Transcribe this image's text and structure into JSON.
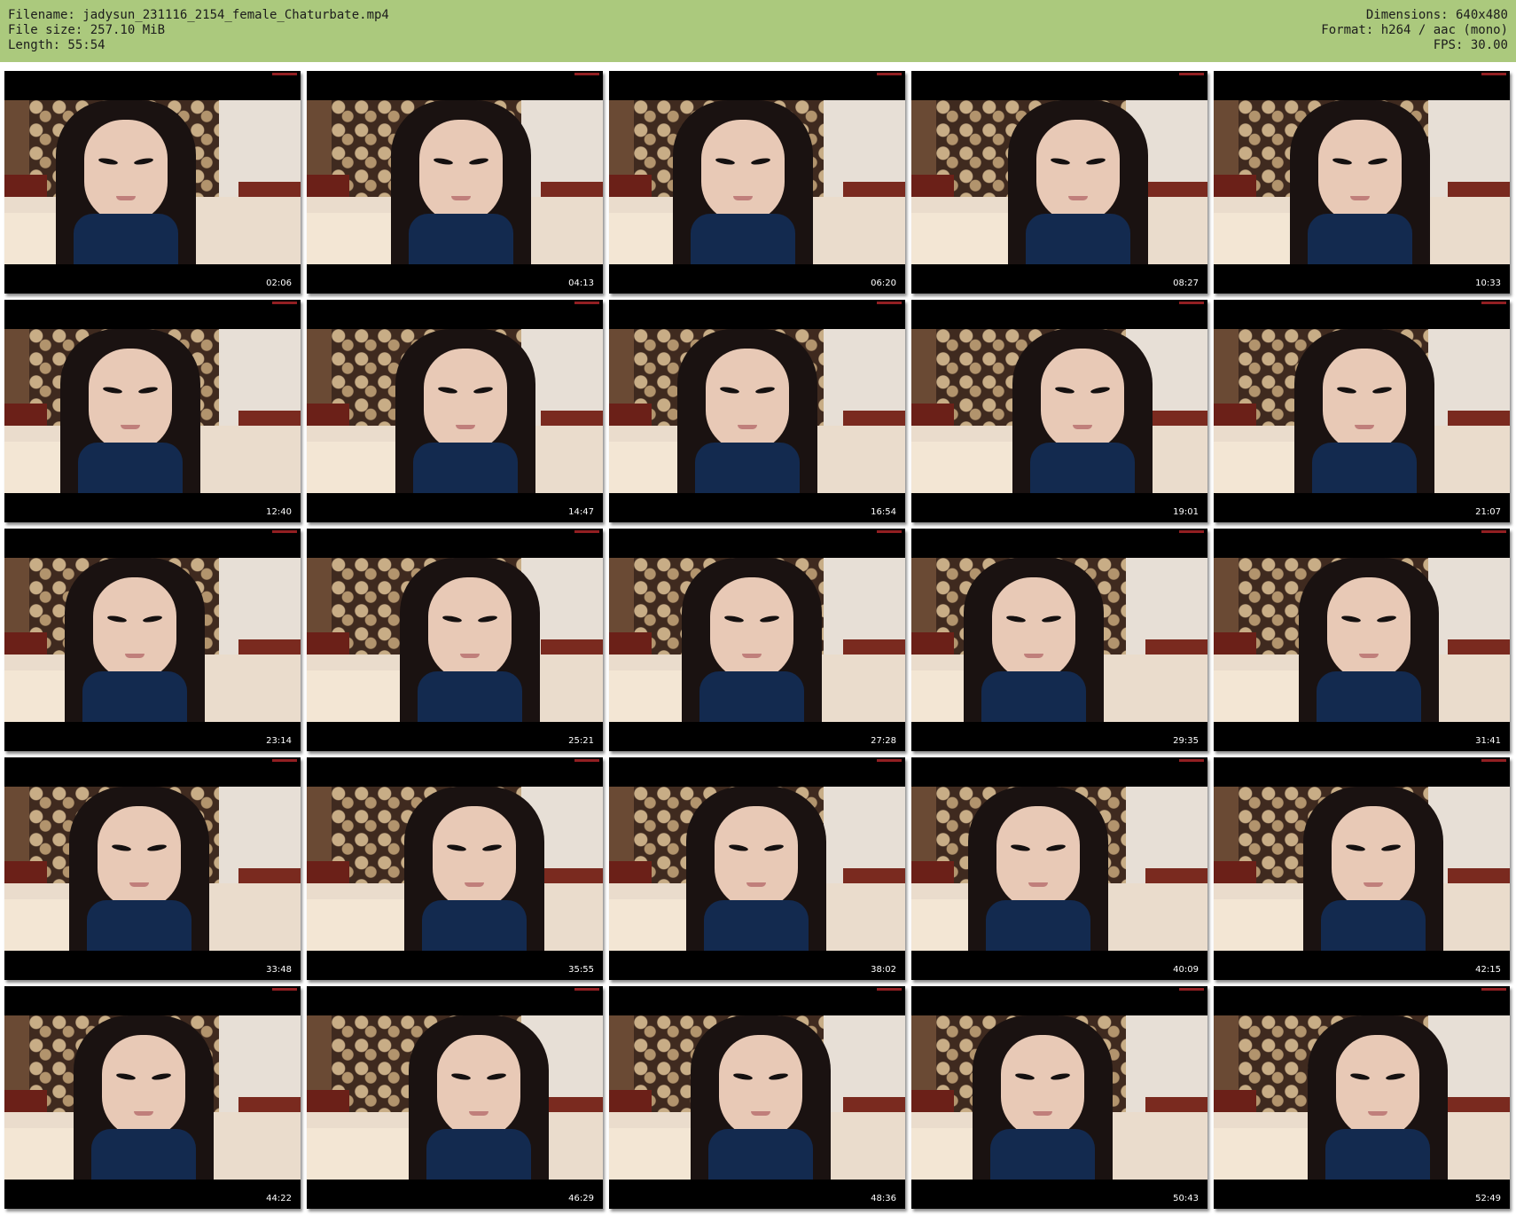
{
  "header": {
    "left": [
      "Filename: jadysun_231116_2154_female_Chaturbate.mp4",
      "File size: 257.10 MiB",
      "Length: 55:54"
    ],
    "right": [
      "Dimensions: 640x480",
      "Format: h264 / aac (mono)",
      "FPS: 30.00"
    ]
  },
  "thumbnails": [
    "02:06",
    "04:13",
    "06:20",
    "08:27",
    "10:33",
    "12:40",
    "14:47",
    "16:54",
    "19:01",
    "21:07",
    "23:14",
    "25:21",
    "27:28",
    "29:35",
    "31:41",
    "33:48",
    "35:55",
    "38:02",
    "40:09",
    "42:15",
    "44:22",
    "46:29",
    "48:36",
    "50:43",
    "52:49"
  ],
  "colors": {
    "header_bg": "#abc97d",
    "thumb_border": "#000000",
    "timestamp": "#ffffff"
  }
}
